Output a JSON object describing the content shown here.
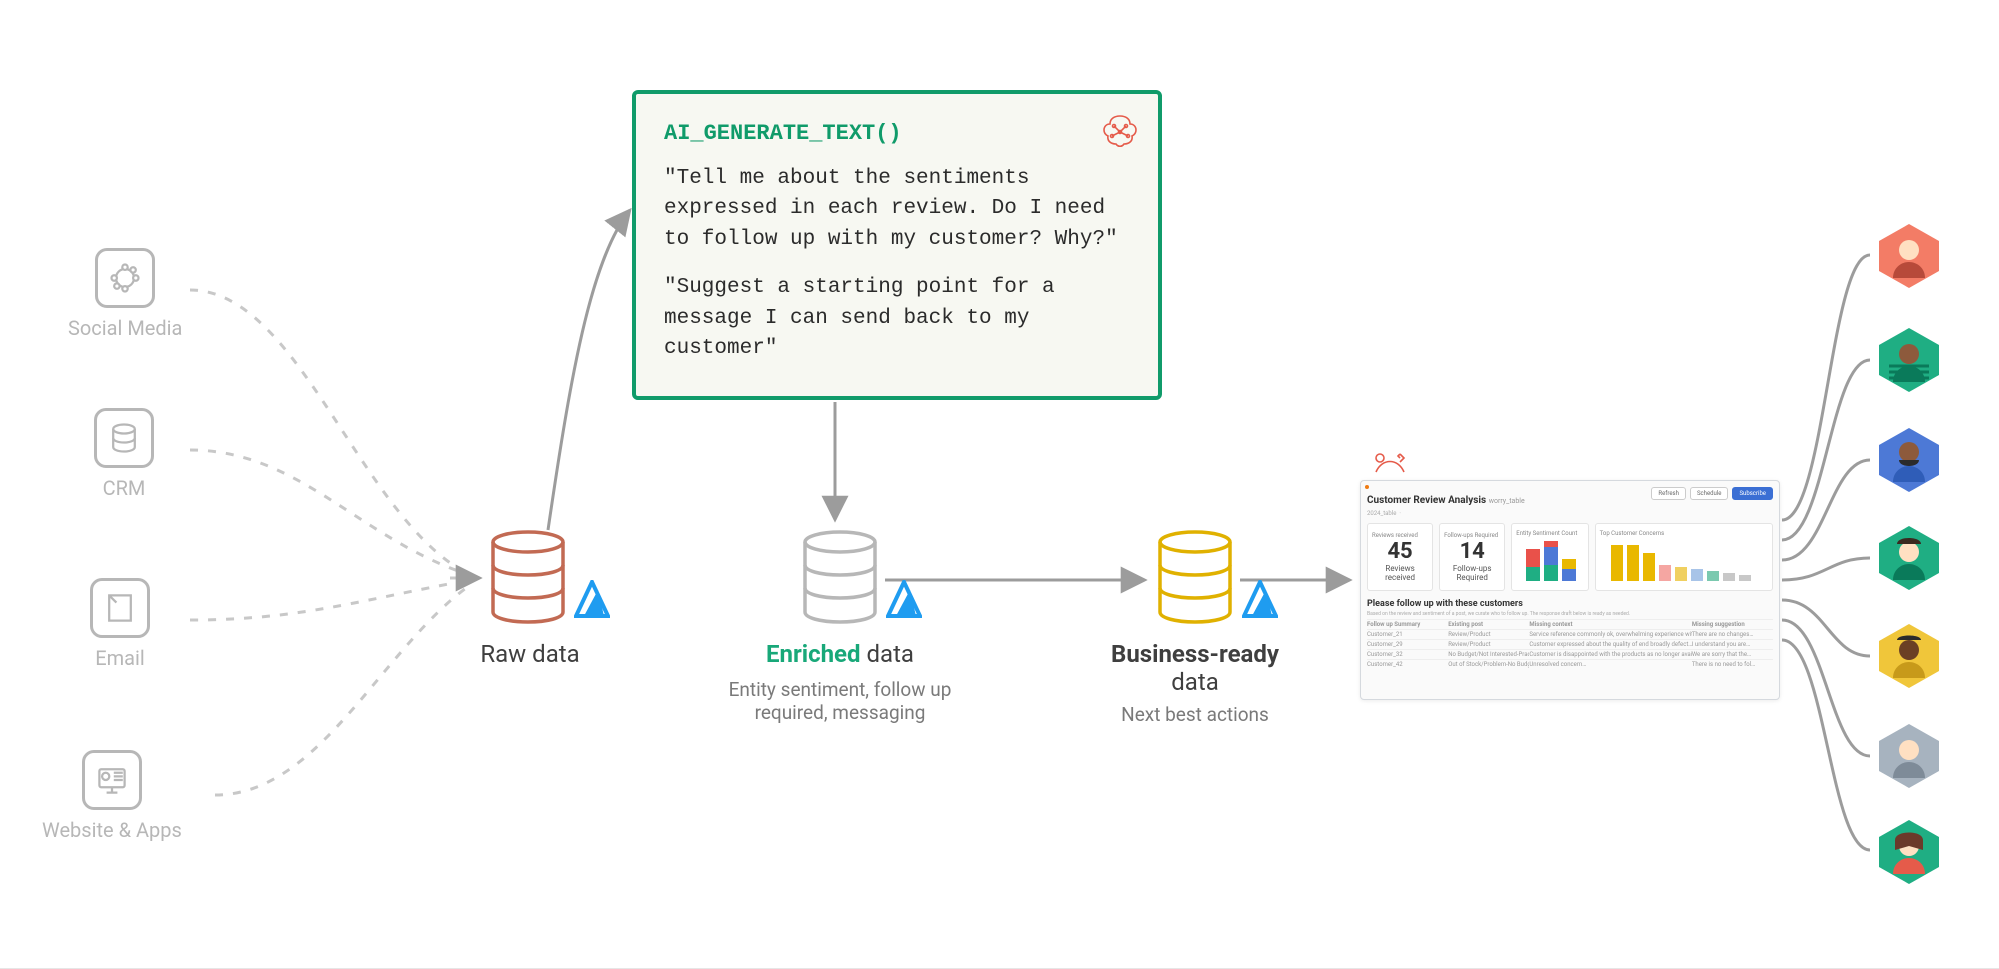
{
  "sources": [
    {
      "label": "Social Media"
    },
    {
      "label": "CRM"
    },
    {
      "label": "Email"
    },
    {
      "label": "Website & Apps"
    }
  ],
  "stages": {
    "raw": {
      "title_plain": "Raw data"
    },
    "enriched": {
      "title_accent": "Enriched",
      "title_rest": " data",
      "sub": "Entity sentiment, follow up required, messaging"
    },
    "business": {
      "title_bold": "Business-ready",
      "title_rest": "data",
      "sub": "Next best actions"
    }
  },
  "ai": {
    "fn": "AI_GENERATE_TEXT()",
    "p1": "\"Tell me about the sentiments expressed in each review. Do I need to follow up with my customer? Why?\"",
    "p2": "\"Suggest a starting point for a message I can send back to my customer\""
  },
  "dashboard": {
    "title": "Customer Review Analysis",
    "subtitle": "worry_table",
    "buttons": {
      "b1": "Refresh",
      "b2": "Schedule",
      "b3": "Subscribe"
    },
    "reviews": {
      "val": "45",
      "label": "Reviews received"
    },
    "followups": {
      "val": "14",
      "label": "Follow-ups Required"
    },
    "panel3": "Follow-ups Required",
    "panel4": "Entity Sentiment Count",
    "panel5": "Top Customer Concerns",
    "table": {
      "title": "Please follow up with these customers",
      "sub": "Based on the review and sentiment of a post, we curate who to follow up. The response draft below is ready as needed.",
      "h1": "Follow up Summary",
      "h2": "Existing post",
      "h3": "Missing context",
      "h4": "Missing suggestion",
      "rows": [
        {
          "c1": "Customer_21",
          "c2": "Review/Product",
          "c3": "Service reference commonly ok, overwhelming experience within…",
          "c4": "There are no changes…"
        },
        {
          "c1": "Customer_29",
          "c2": "Review/Product",
          "c3": "Customer expressed about the quality of end broadly defect…",
          "c4": "I understand you are…"
        },
        {
          "c1": "Customer_32",
          "c2": "No Budget/Not Interested-Practice Mix",
          "c3": "Customer is disappointed with the products as no longer available at their local store…",
          "c4": "We are sorry that the…"
        },
        {
          "c1": "Customer_42",
          "c2": "Out of Stock/Problem-No Budget-Not Int…",
          "c3": "Unresolved concern…",
          "c4": "There is no need to fol…"
        }
      ]
    }
  }
}
